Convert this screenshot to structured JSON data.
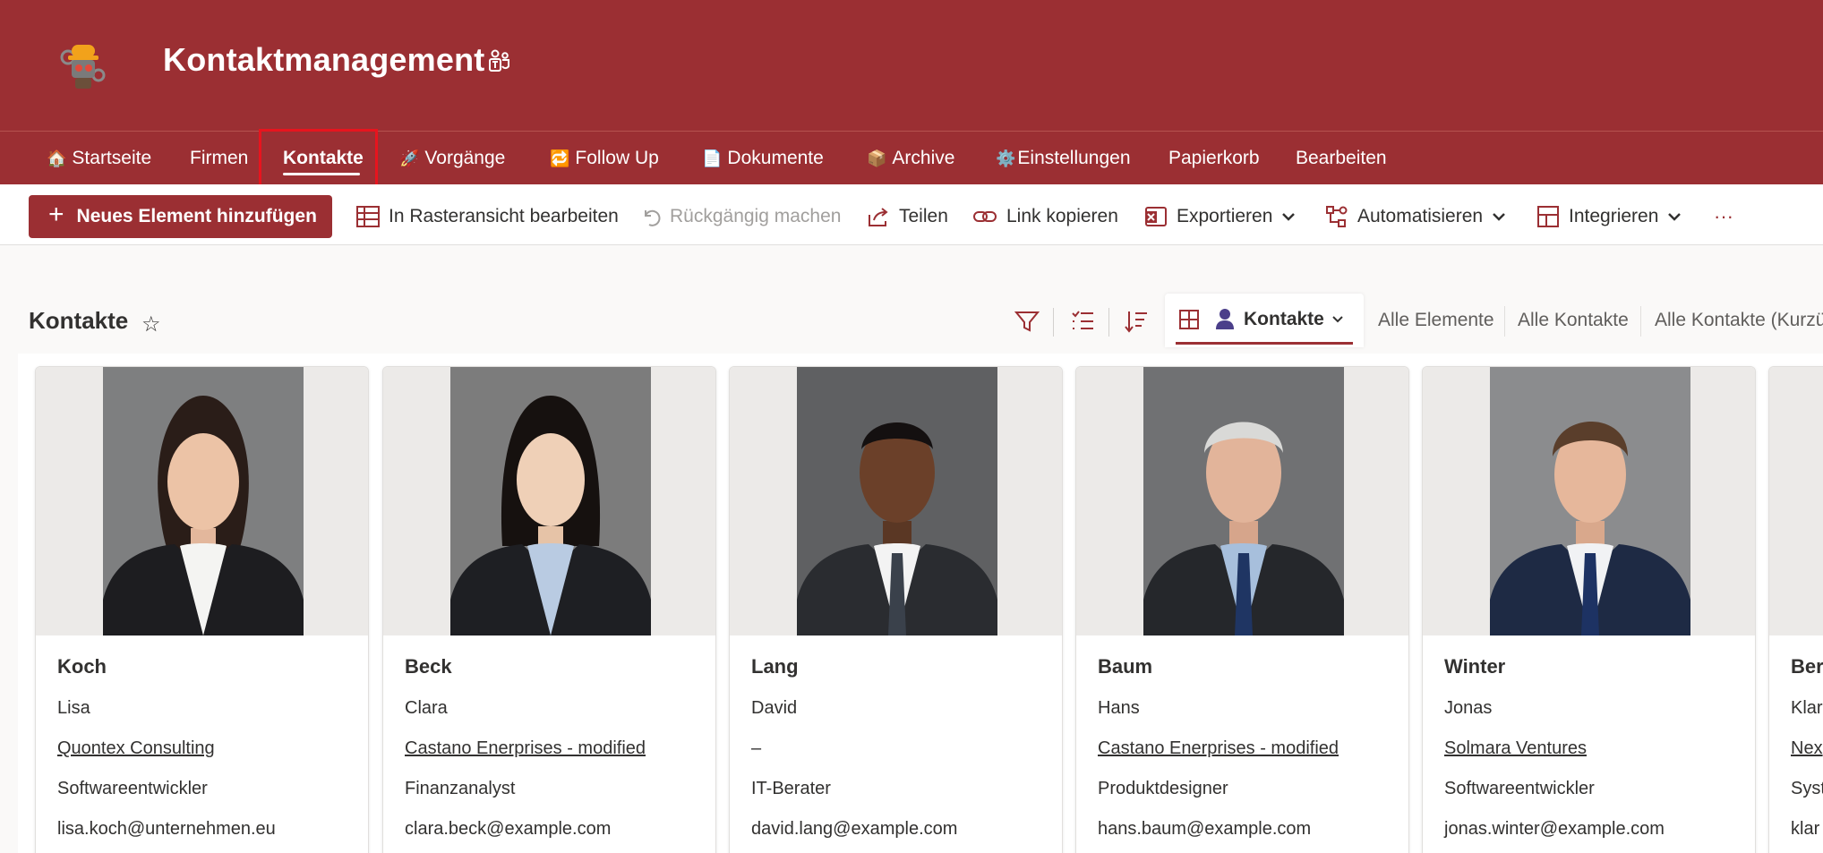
{
  "site": {
    "title": "Kontaktmanagement"
  },
  "nav": [
    {
      "label": "Startseite",
      "emoji": "🏠"
    },
    {
      "label": "Firmen",
      "emoji": ""
    },
    {
      "label": "Kontakte",
      "emoji": ""
    },
    {
      "label": "Vorgänge",
      "emoji": "🚀"
    },
    {
      "label": "Follow Up",
      "emoji": "🔁"
    },
    {
      "label": "Dokumente",
      "emoji": "📄"
    },
    {
      "label": "Archive",
      "emoji": "📦"
    },
    {
      "label": "Einstellungen",
      "emoji": "⚙️"
    },
    {
      "label": "Papierkorb",
      "emoji": ""
    },
    {
      "label": "Bearbeiten",
      "emoji": ""
    }
  ],
  "commands": {
    "new_item": "Neues Element hinzufügen",
    "grid_edit": "In Rasteransicht bearbeiten",
    "undo": "Rückgängig machen",
    "share": "Teilen",
    "copy_link": "Link kopieren",
    "export": "Exportieren",
    "automate": "Automatisieren",
    "integrate": "Integrieren",
    "more": "···"
  },
  "view": {
    "title": "Kontakte",
    "current_view": "Kontakte",
    "other_views": [
      "Alle Elemente",
      "Alle Kontakte",
      "Alle Kontakte (Kurzü"
    ]
  },
  "contacts": [
    {
      "last": "Koch",
      "first": "Lisa",
      "company": "Quontex Consulting",
      "role": "Softwareentwickler",
      "email": "lisa.koch@unternehmen.eu"
    },
    {
      "last": "Beck",
      "first": "Clara",
      "company": "Castano Enerprises - modified",
      "role": "Finanzanalyst",
      "email": "clara.beck@example.com"
    },
    {
      "last": "Lang",
      "first": "David",
      "company": "–",
      "role": "IT-Berater",
      "email": "david.lang@example.com"
    },
    {
      "last": "Baum",
      "first": "Hans",
      "company": "Castano Enerprises - modified",
      "role": "Produktdesigner",
      "email": "hans.baum@example.com"
    },
    {
      "last": "Winter",
      "first": "Jonas",
      "company": "Solmara Ventures",
      "role": "Softwareentwickler",
      "email": "jonas.winter@example.com"
    },
    {
      "last": "Berg",
      "first": "Klar",
      "company": "Nex",
      "role": "Syst",
      "email": "klar"
    }
  ],
  "colors": {
    "brand": "#9b2f33",
    "highlight": "#e8141e"
  }
}
